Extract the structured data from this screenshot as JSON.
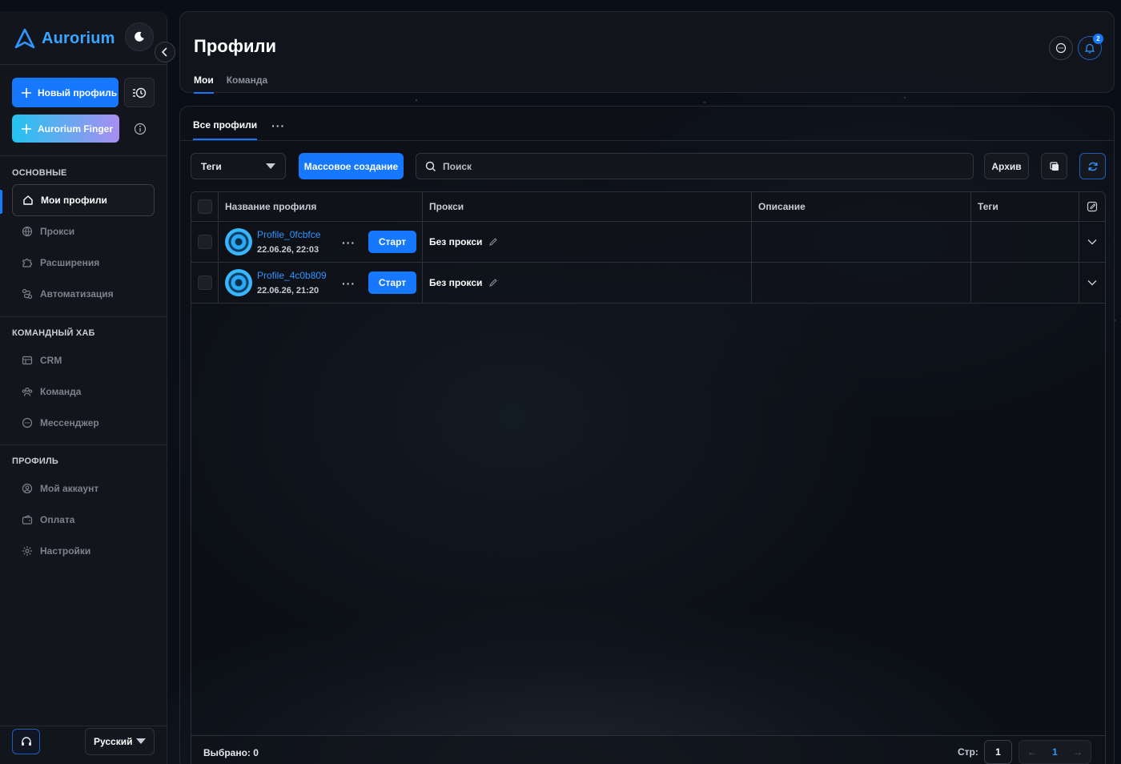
{
  "app": {
    "brand": "Aurorium",
    "accent": "#1677ff"
  },
  "sidebar": {
    "new_profile": "Новый профиль",
    "finger": "Aurorium Finger",
    "sections": [
      {
        "title": "ОСНОВНЫЕ",
        "items": [
          {
            "label": "Мои профили",
            "icon": "home-icon",
            "active": true
          },
          {
            "label": "Прокси",
            "icon": "globe-icon"
          },
          {
            "label": "Расширения",
            "icon": "puzzle-icon"
          },
          {
            "label": "Автоматизация",
            "icon": "automation-icon"
          }
        ]
      },
      {
        "title": "КОМАНДНЫЙ ХАБ",
        "items": [
          {
            "label": "CRM",
            "icon": "crm-icon"
          },
          {
            "label": "Команда",
            "icon": "team-icon"
          },
          {
            "label": "Мессенджер",
            "icon": "chat-icon"
          }
        ]
      },
      {
        "title": "ПРОФИЛЬ",
        "items": [
          {
            "label": "Мой аккаунт",
            "icon": "user-icon"
          },
          {
            "label": "Оплата",
            "icon": "wallet-icon"
          },
          {
            "label": "Настройки",
            "icon": "gear-icon"
          }
        ]
      }
    ],
    "language": "Русский"
  },
  "header": {
    "title": "Профили",
    "tabs": [
      "Мои",
      "Команда"
    ],
    "notifications_count": "2"
  },
  "main": {
    "list_tab": "Все профили",
    "list_tab_more": "···",
    "toolbar": {
      "tags_label": "Теги",
      "bulk_create": "Массовое создание",
      "search_placeholder": "Поиск",
      "archive": "Архив"
    },
    "table": {
      "columns": [
        "Название профиля",
        "Прокси",
        "Описание",
        "Теги"
      ],
      "rows": [
        {
          "name": "Profile_0fcbfce",
          "date": "22.06.26, 22:03",
          "more": "···",
          "start": "Старт",
          "proxy": "Без прокси",
          "description": "",
          "tags": ""
        },
        {
          "name": "Profile_4c0b809",
          "date": "22.06.26, 21:20",
          "more": "···",
          "start": "Старт",
          "proxy": "Без прокси",
          "description": "",
          "tags": ""
        }
      ]
    },
    "footer": {
      "selected": "Выбрано: 0",
      "page_label": "Стр:",
      "page_value": "1",
      "prev": "←",
      "current": "1",
      "next": "→"
    }
  }
}
